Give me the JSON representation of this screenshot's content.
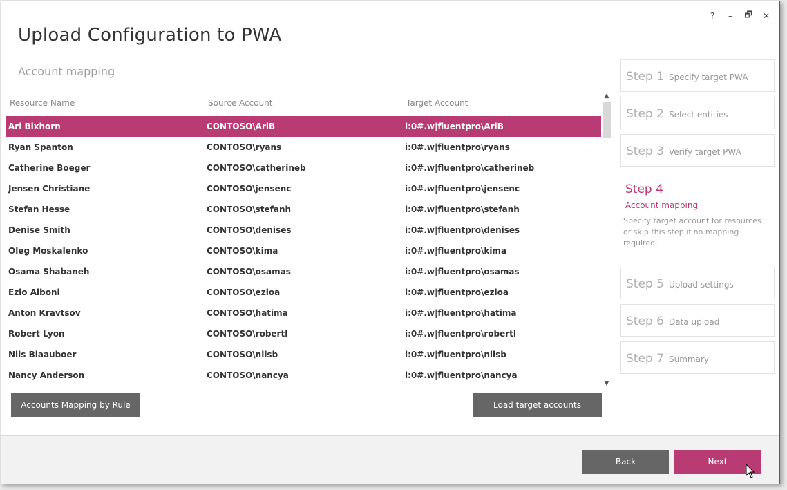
{
  "window": {
    "title": "Upload Configuration to PWA",
    "controls": {
      "help": "?",
      "minimize": "–",
      "restore": "🗗",
      "close": "✕"
    }
  },
  "subtitle": "Account mapping",
  "grid": {
    "columns": [
      "Resource Name",
      "Source Account",
      "Target Account"
    ],
    "rows": [
      {
        "name": "Ari Bixhorn",
        "source": "CONTOSO\\AriB",
        "target": "i:0#.w|fluentpro\\AriB",
        "selected": true
      },
      {
        "name": "Ryan Spanton",
        "source": "CONTOSO\\ryans",
        "target": "i:0#.w|fluentpro\\ryans"
      },
      {
        "name": "Catherine Boeger",
        "source": "CONTOSO\\catherineb",
        "target": "i:0#.w|fluentpro\\catherineb"
      },
      {
        "name": "Jensen Christiane",
        "source": "CONTOSO\\jensenc",
        "target": "i:0#.w|fluentpro\\jensenc"
      },
      {
        "name": "Stefan Hesse",
        "source": "CONTOSO\\stefanh",
        "target": "i:0#.w|fluentpro\\stefanh"
      },
      {
        "name": "Denise Smith",
        "source": "CONTOSO\\denises",
        "target": "i:0#.w|fluentpro\\denises"
      },
      {
        "name": "Oleg Moskalenko",
        "source": "CONTOSO\\kima",
        "target": "i:0#.w|fluentpro\\kima"
      },
      {
        "name": "Osama Shabaneh",
        "source": "CONTOSO\\osamas",
        "target": "i:0#.w|fluentpro\\osamas"
      },
      {
        "name": "Ezio Alboni",
        "source": "CONTOSO\\ezioa",
        "target": "i:0#.w|fluentpro\\ezioa"
      },
      {
        "name": "Anton Kravtsov",
        "source": "CONTOSO\\hatima",
        "target": "i:0#.w|fluentpro\\hatima"
      },
      {
        "name": "Robert Lyon",
        "source": "CONTOSO\\robertl",
        "target": "i:0#.w|fluentpro\\robertl"
      },
      {
        "name": "Nils Blaauboer",
        "source": "CONTOSO\\nilsb",
        "target": "i:0#.w|fluentpro\\nilsb"
      },
      {
        "name": "Nancy Anderson",
        "source": "CONTOSO\\nancya",
        "target": "i:0#.w|fluentpro\\nancya"
      }
    ]
  },
  "buttons": {
    "mapping_by_rule": "Accounts Mapping by Rule",
    "load_target": "Load target accounts",
    "back": "Back",
    "next": "Next"
  },
  "steps": [
    {
      "num": "Step 1",
      "label": "Specify target PWA"
    },
    {
      "num": "Step 2",
      "label": "Select entities"
    },
    {
      "num": "Step 3",
      "label": "Verify target PWA"
    },
    {
      "num": "Step 4",
      "label": "Account mapping",
      "desc": "Specify target account for resources or skip this step if no mapping required.",
      "active": true
    },
    {
      "num": "Step 5",
      "label": "Upload settings"
    },
    {
      "num": "Step 6",
      "label": "Data upload"
    },
    {
      "num": "Step 7",
      "label": "Summary"
    }
  ],
  "colors": {
    "accent": "#b93b73",
    "button_gray": "#666666"
  },
  "icons": {
    "scroll_up": "▲",
    "scroll_down": "▼"
  }
}
